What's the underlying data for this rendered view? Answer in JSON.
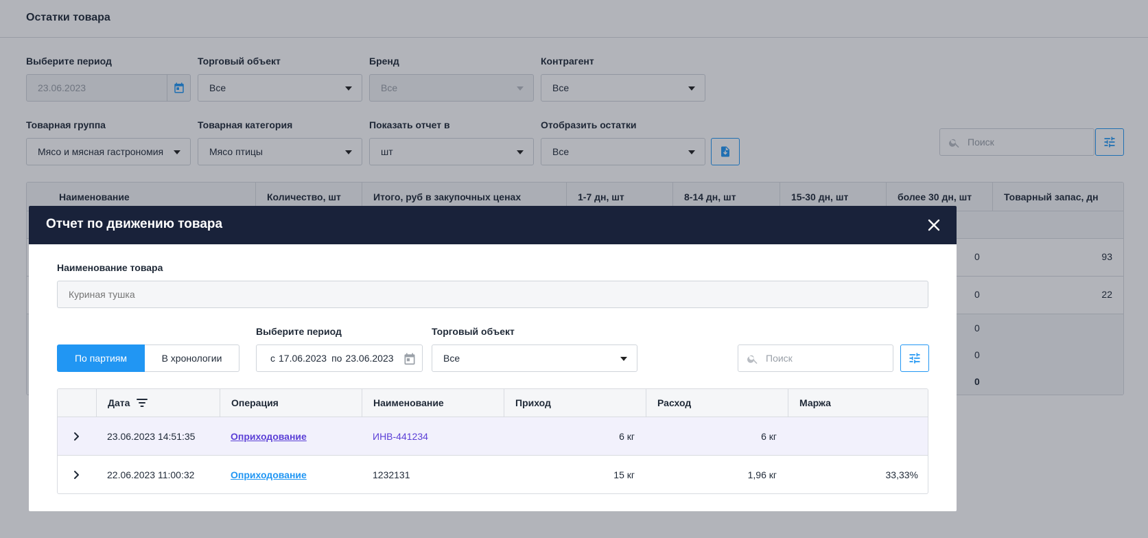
{
  "page": {
    "title": "Остатки товара",
    "filters": {
      "period": {
        "label": "Выберите период",
        "value": "23.06.2023"
      },
      "store": {
        "label": "Торговый объект",
        "value": "Все"
      },
      "brand": {
        "label": "Бренд",
        "value": "Все"
      },
      "counterparty": {
        "label": "Контрагент",
        "value": "Все"
      },
      "product_group": {
        "label": "Товарная группа",
        "value": "Мясо и мясная гастрономия"
      },
      "product_category": {
        "label": "Товарная категория",
        "value": "Мясо птицы"
      },
      "report_unit": {
        "label": "Показать отчет в",
        "value": "шт"
      },
      "show_stock": {
        "label": "Отобразить остатки",
        "value": "Все"
      }
    },
    "search": {
      "placeholder": "Поиск"
    },
    "table": {
      "columns": [
        "Наименование",
        "Количество, шт",
        "Итого, руб в закупочных ценах",
        "1-7 дн, шт",
        "8-14 дн, шт",
        "15-30 дн, шт",
        "более 30 дн, шт",
        "Товарный запас, дн"
      ],
      "rows": [
        {
          "over30": "0",
          "stock_days": "93"
        },
        {
          "over30": "0",
          "stock_days": "22"
        }
      ],
      "footer": [
        "0",
        "0",
        "0"
      ]
    }
  },
  "modal": {
    "title": "Отчет по движению товара",
    "product_name": {
      "label": "Наименование товара",
      "placeholder": "Куриная тушка"
    },
    "tabs": {
      "by_batches": "По партиям",
      "chronology": "В хронологии"
    },
    "period": {
      "label": "Выберите период",
      "from_prefix": "с",
      "from": "17.06.2023",
      "to_prefix": "по",
      "to": "23.06.2023"
    },
    "store": {
      "label": "Торговый объект",
      "value": "Все"
    },
    "search": {
      "placeholder": "Поиск"
    },
    "table": {
      "columns": {
        "date": "Дата",
        "operation": "Операция",
        "name": "Наименование",
        "income": "Приход",
        "expense": "Расход",
        "margin": "Маржа"
      },
      "rows": [
        {
          "date": "23.06.2023 14:51:35",
          "operation": "Оприходование",
          "name": "ИНВ-441234",
          "income": "6 кг",
          "expense": "6 кг",
          "margin": ""
        },
        {
          "date": "22.06.2023 11:00:32",
          "operation": "Оприходование",
          "name": "1232131",
          "income": "15 кг",
          "expense": "1,96 кг",
          "margin": "33,33%"
        }
      ]
    }
  },
  "colors": {
    "accent": "#2196f3",
    "modal_header": "#19223a",
    "link_visited": "#5b3fd6"
  }
}
